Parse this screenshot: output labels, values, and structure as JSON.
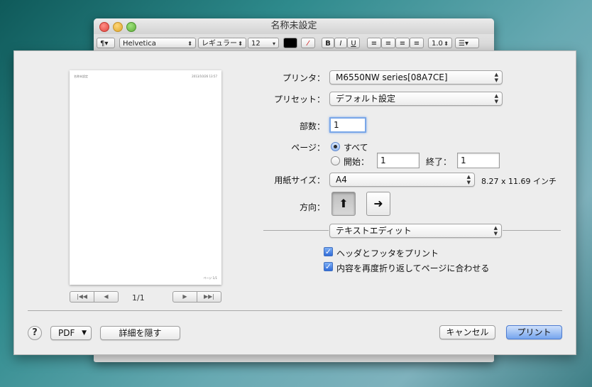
{
  "window": {
    "title": "名称未設定",
    "toolbar": {
      "paragraph": "¶▾",
      "font_family": "Helvetica",
      "font_style": "レギュラー",
      "font_size": "12",
      "bold": "B",
      "italic": "I",
      "underline": "U",
      "line_spacing": "1.0",
      "list": "☰▾"
    }
  },
  "preview": {
    "header_left": "名称未設定",
    "header_right": "2013/10/26 13:57",
    "footer_right": "ページ 1/1",
    "page_count": "1/1",
    "nav": {
      "first": "|◀◀",
      "prev": "◀",
      "next": "▶",
      "last": "▶▶|"
    }
  },
  "printer": {
    "label": "プリンタ：",
    "value": "M6550NW series[08A7CE]"
  },
  "preset": {
    "label": "プリセット：",
    "value": "デフォルト設定"
  },
  "copies": {
    "label": "部数：",
    "value": "1"
  },
  "pages": {
    "label": "ページ：",
    "all_label": "すべて",
    "from_label": "開始：",
    "from_value": "1",
    "to_label": "終了：",
    "to_value": "1"
  },
  "paper": {
    "label": "用紙サイズ：",
    "value": "A4",
    "dims": "8.27 x 11.69 インチ"
  },
  "orientation": {
    "label": "方向："
  },
  "section": {
    "value": "テキストエディット"
  },
  "options": {
    "header_footer": "ヘッダとフッタをプリント",
    "rewrap": "内容を再度折り返してページに合わせる"
  },
  "buttons": {
    "help": "?",
    "pdf": "PDF",
    "hide_details": "詳細を隠す",
    "cancel": "キャンセル",
    "print": "プリント"
  }
}
